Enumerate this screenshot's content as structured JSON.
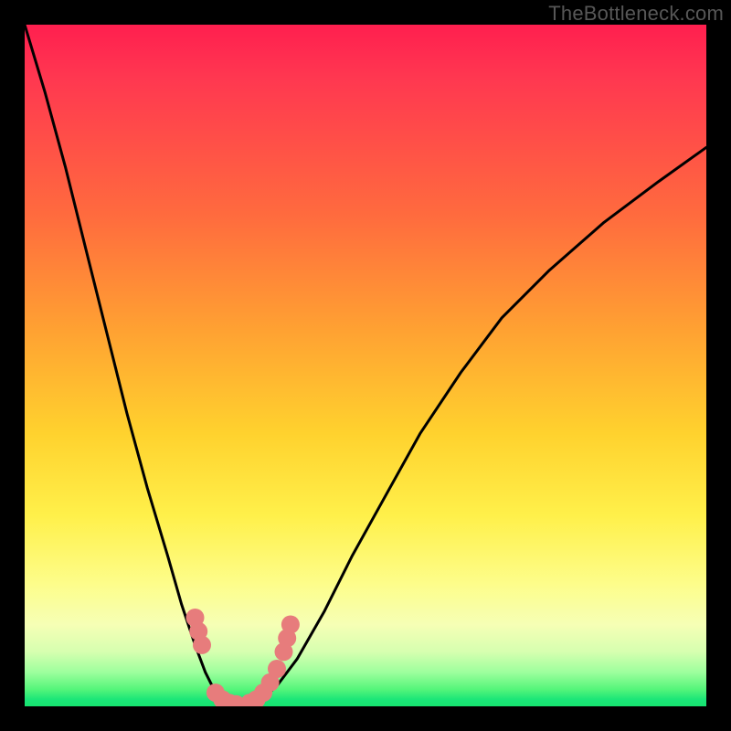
{
  "watermark": "TheBottleneck.com",
  "chart_data": {
    "type": "line",
    "title": "",
    "xlabel": "",
    "ylabel": "",
    "xlim": [
      0,
      100
    ],
    "ylim": [
      0,
      100
    ],
    "grid": false,
    "legend": false,
    "background_gradient": {
      "direction": "top-to-bottom",
      "stops": [
        {
          "pos": 0,
          "color": "#ff1f4f"
        },
        {
          "pos": 28,
          "color": "#ff6b3e"
        },
        {
          "pos": 60,
          "color": "#ffd22e"
        },
        {
          "pos": 82,
          "color": "#fdfd8a"
        },
        {
          "pos": 95,
          "color": "#9dff9d"
        },
        {
          "pos": 100,
          "color": "#16e36f"
        }
      ]
    },
    "series": [
      {
        "name": "curve",
        "stroke": "#000000",
        "x": [
          0,
          3,
          6,
          9,
          12,
          15,
          18,
          21,
          23,
          25,
          26.5,
          28,
          29.5,
          31,
          33,
          35,
          37,
          40,
          44,
          48,
          53,
          58,
          64,
          70,
          77,
          85,
          93,
          100
        ],
        "y": [
          100,
          90,
          79,
          67,
          55,
          43,
          32,
          22,
          15,
          9,
          5,
          2,
          0.5,
          0,
          0.3,
          1.2,
          3,
          7,
          14,
          22,
          31,
          40,
          49,
          57,
          64,
          71,
          77,
          82
        ]
      }
    ],
    "markers": [
      {
        "name": "cluster-left",
        "color": "#e77c7c",
        "r": 10,
        "points_xy": [
          [
            25,
            13
          ],
          [
            25.5,
            11
          ],
          [
            26,
            9
          ]
        ]
      },
      {
        "name": "trough-left",
        "color": "#e77c7c",
        "r": 10,
        "points_xy": [
          [
            28,
            2
          ],
          [
            29,
            1
          ],
          [
            30,
            0.5
          ],
          [
            31,
            0.3
          ]
        ]
      },
      {
        "name": "trough-right",
        "color": "#e77c7c",
        "r": 10,
        "points_xy": [
          [
            33,
            0.5
          ],
          [
            34,
            1
          ],
          [
            35,
            2
          ],
          [
            36,
            3.5
          ],
          [
            37,
            5.5
          ]
        ]
      },
      {
        "name": "cluster-right",
        "color": "#e77c7c",
        "r": 10,
        "points_xy": [
          [
            38,
            8
          ],
          [
            38.5,
            10
          ],
          [
            39,
            12
          ]
        ]
      }
    ]
  }
}
